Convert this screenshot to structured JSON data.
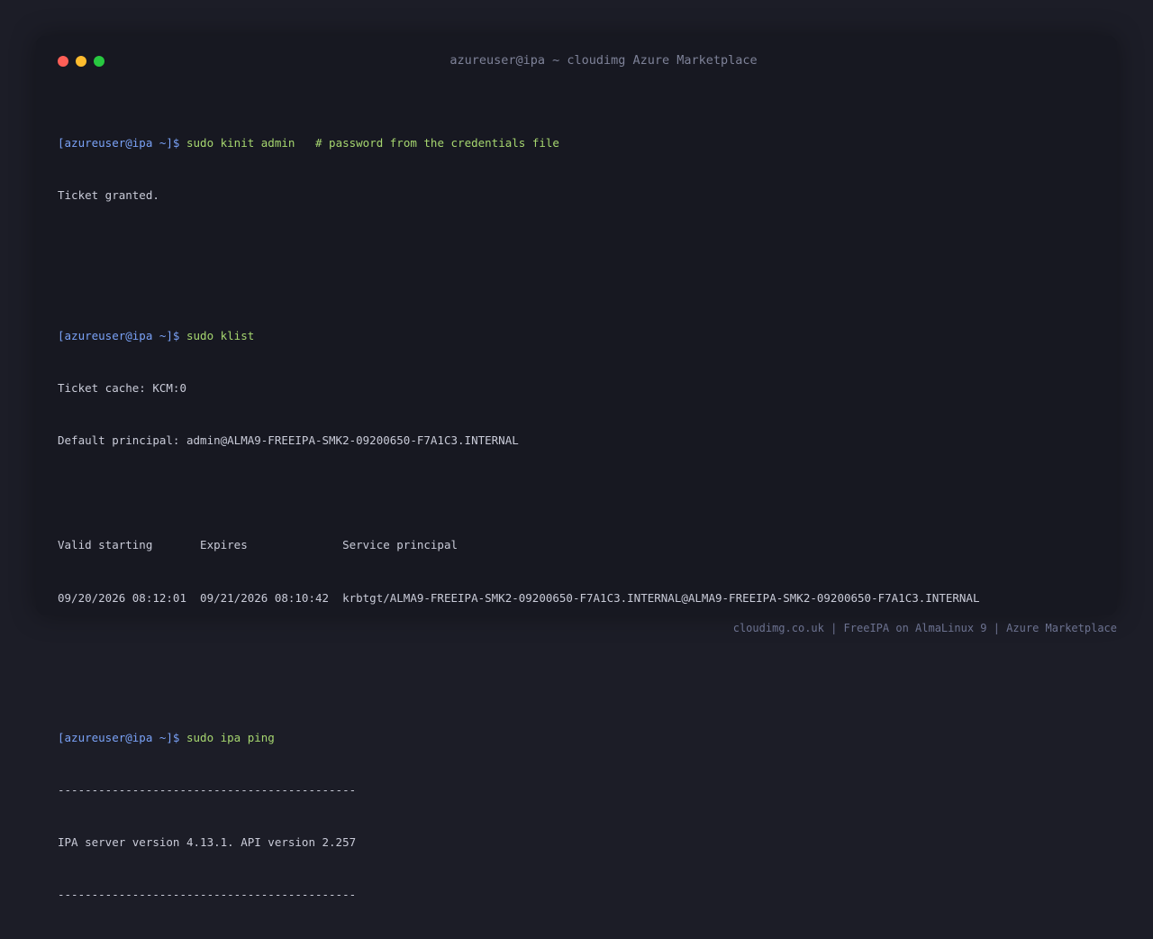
{
  "window": {
    "title": "azureuser@ipa ~ cloudimg Azure Marketplace"
  },
  "terminal": {
    "blocks": [
      {
        "prompt": "[azureuser@ipa ~]$",
        "command": "sudo kinit admin",
        "comment": "# password from the credentials file",
        "output": [
          "Ticket granted."
        ]
      },
      {
        "prompt": "[azureuser@ipa ~]$",
        "command": "sudo klist",
        "output": [
          "Ticket cache: KCM:0",
          "Default principal: admin@ALMA9-FREEIPA-SMK2-09200650-F7A1C3.INTERNAL",
          "",
          "Valid starting       Expires              Service principal",
          "09/20/2026 08:12:01  09/21/2026 08:10:42  krbtgt/ALMA9-FREEIPA-SMK2-09200650-F7A1C3.INTERNAL@ALMA9-FREEIPA-SMK2-09200650-F7A1C3.INTERNAL"
        ]
      },
      {
        "prompt": "[azureuser@ipa ~]$",
        "command": "sudo ipa ping",
        "output": [
          "--------------------------------------------",
          "IPA server version 4.13.1. API version 2.257",
          "--------------------------------------------"
        ]
      }
    ]
  },
  "footer": {
    "text": "cloudimg.co.uk | FreeIPA on AlmaLinux 9 | Azure Marketplace"
  },
  "colors": {
    "background": "#1c1d27",
    "window": "#171821",
    "prompt": "#7aa2f7",
    "command": "#a6d66f",
    "output": "#c9cbd8",
    "close": "#ff5f57",
    "minimize": "#febc2e",
    "maximize": "#28c840"
  }
}
